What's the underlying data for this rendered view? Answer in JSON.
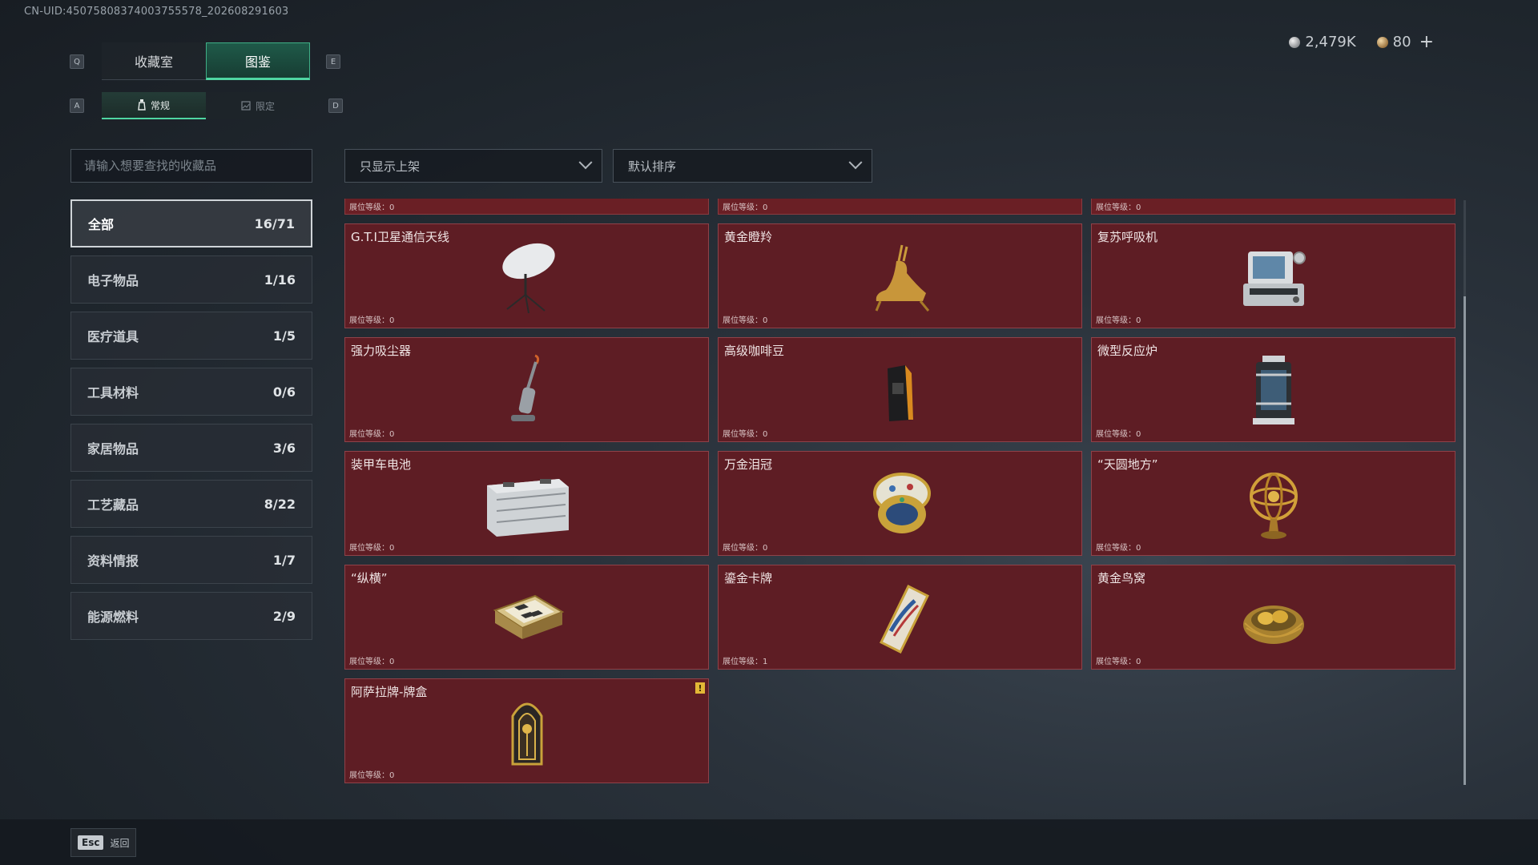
{
  "uid": "CN-UID:45075808374003755578_202608291603",
  "currency": {
    "silver": "2,479K",
    "bronze": "80",
    "plus": "+"
  },
  "keys": {
    "q": "Q",
    "e": "E",
    "a": "A",
    "d": "D"
  },
  "tabs": [
    {
      "label": "收藏室",
      "active": false
    },
    {
      "label": "图鉴",
      "active": true
    }
  ],
  "subtabs": [
    {
      "label": "常规",
      "active": true
    },
    {
      "label": "限定",
      "active": false
    }
  ],
  "search": {
    "placeholder": "请输入想要查找的收藏品"
  },
  "filters": {
    "display": "只显示上架",
    "sort": "默认排序"
  },
  "categories": [
    {
      "label": "全部",
      "count": "16/71",
      "active": true
    },
    {
      "label": "电子物品",
      "count": "1/16"
    },
    {
      "label": "医疗道具",
      "count": "1/5"
    },
    {
      "label": "工具材料",
      "count": "0/6"
    },
    {
      "label": "家居物品",
      "count": "3/6"
    },
    {
      "label": "工艺藏品",
      "count": "8/22"
    },
    {
      "label": "资料情报",
      "count": "1/7"
    },
    {
      "label": "能源燃料",
      "count": "2/9"
    }
  ],
  "peek_row": [
    {
      "level": "展位等级：0"
    },
    {
      "level": "展位等级：0"
    },
    {
      "level": "展位等级：0"
    }
  ],
  "items": [
    {
      "name": "G.T.I卫星通信天线",
      "level": "展位等级：0",
      "icon": "satellite-dish-icon"
    },
    {
      "name": "黄金瞪羚",
      "level": "展位等级：0",
      "icon": "golden-gazelle-icon"
    },
    {
      "name": "复苏呼吸机",
      "level": "展位等级：0",
      "icon": "ventilator-icon"
    },
    {
      "name": "强力吸尘器",
      "level": "展位等级：0",
      "icon": "vacuum-cleaner-icon"
    },
    {
      "name": "高级咖啡豆",
      "level": "展位等级：0",
      "icon": "coffee-bag-icon"
    },
    {
      "name": "微型反应炉",
      "level": "展位等级：0",
      "icon": "mini-reactor-icon"
    },
    {
      "name": "装甲车电池",
      "level": "展位等级：0",
      "icon": "vehicle-battery-icon"
    },
    {
      "name": "万金泪冠",
      "level": "展位等级：0",
      "icon": "jeweled-egg-icon"
    },
    {
      "name": "“天圆地方”",
      "level": "展位等级：0",
      "icon": "armillary-sphere-icon"
    },
    {
      "name": "“纵横”",
      "level": "展位等级：0",
      "icon": "chess-box-icon"
    },
    {
      "name": "鎏金卡牌",
      "level": "展位等级：1",
      "icon": "gilded-card-icon"
    },
    {
      "name": "黄金鸟窝",
      "level": "展位等级：0",
      "icon": "golden-nest-icon"
    },
    {
      "name": "阿萨拉牌-牌盒",
      "level": "展位等级：0",
      "icon": "card-case-icon",
      "alert": "!"
    }
  ],
  "footer": {
    "esc_key": "Esc",
    "esc_label": "返回"
  },
  "colors": {
    "accent": "#4fd6a2",
    "card_bg": "#5e1d24",
    "card_border": "#8f4249",
    "alert": "#e2b736"
  }
}
